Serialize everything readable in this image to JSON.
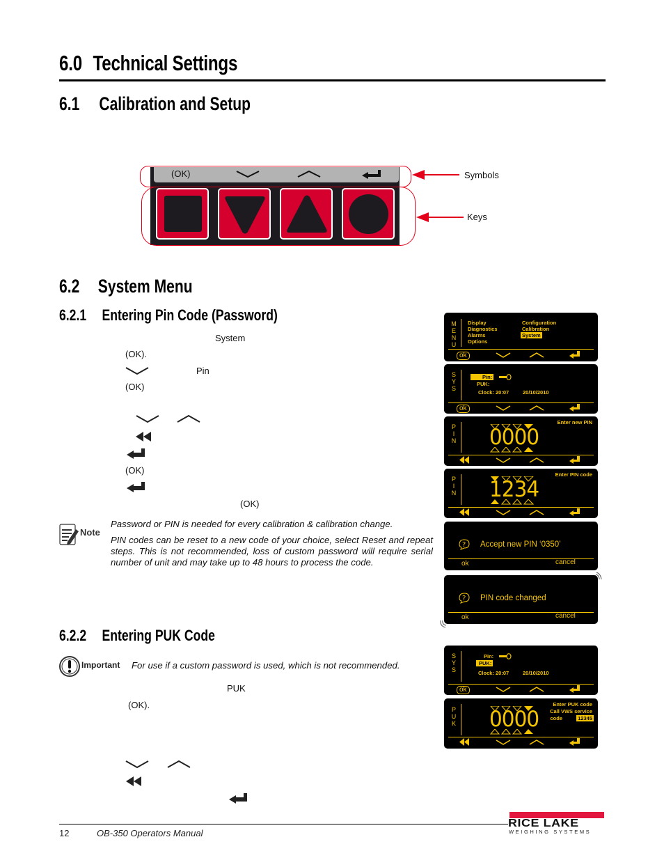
{
  "page": {
    "h1": "6.0  Technical Settings",
    "h1_num": "6.0",
    "h1_title": "Technical Settings",
    "s61_num": "6.1",
    "s61_title": "Calibration and Setup",
    "s62_num": "6.2",
    "s62_title": "System Menu",
    "s621_num": "6.2.1",
    "s621_title": "Entering Pin Code (Password)",
    "s622_num": "6.2.2",
    "s622_title": "Entering PUK Code"
  },
  "keypad": {
    "symbols": [
      "(OK)",
      "chevron-down",
      "chevron-up",
      "enter"
    ],
    "keys": [
      "square",
      "triangle-down",
      "triangle-up",
      "circle"
    ],
    "callout_symbols": "Symbols",
    "callout_keys": "Keys",
    "accent": "#d6002f"
  },
  "pin_steps": {
    "s1_word": "System",
    "s2_ok": "(OK).",
    "s3_word": "Pin",
    "s4_ok": "(OK)",
    "s8_ok": "(OK)",
    "s10_ok": "(OK)"
  },
  "note": {
    "label": "Note",
    "p1": "Password or PIN is needed for every calibration & calibration change.",
    "p2": "PIN codes can be reset to a new code of your choice, select Reset and repeat steps. This is not recommended, loss of custom password will require serial number of unit and may take up to 48 hours to process the code."
  },
  "important": {
    "label": "Important",
    "text": "For use if a custom password is used, which is not recommended."
  },
  "puk_steps": {
    "s1_word": "PUK",
    "s2_ok": "(OK)."
  },
  "displays": {
    "menu": {
      "side": [
        "M",
        "E",
        "N",
        "U"
      ],
      "col1": [
        "Display",
        "Diagnostics",
        "Alarms",
        "Options"
      ],
      "col2": [
        "Configuration",
        "Calibration",
        "System"
      ],
      "selected": "System",
      "ok": "ok"
    },
    "sys1": {
      "side": [
        "S",
        "Y",
        "S"
      ],
      "pin": "Pin:",
      "puk": "PUK:",
      "clock": "Clock: 20:07",
      "date": "20/10/2010",
      "ok": "ok"
    },
    "pin_new": {
      "side": [
        "P",
        "I",
        "N"
      ],
      "title": "Enter new PIN",
      "digits": "0000"
    },
    "pin_enter": {
      "side": [
        "P",
        "I",
        "N"
      ],
      "title": "Enter PIN code",
      "digits": "1234"
    },
    "confirm": {
      "message": "Accept new PIN ‘0350’",
      "ok": "ok",
      "cancel": "cancel"
    },
    "changed": {
      "message": "PIN code changed",
      "ok": "ok",
      "cancel": "cancel"
    },
    "sys2": {
      "side": [
        "S",
        "Y",
        "S"
      ],
      "pin": "Pin:",
      "puk": "PUK:",
      "clock": "Clock: 20:07",
      "date": "20/10/2010",
      "ok": "ok"
    },
    "puk": {
      "side": [
        "P",
        "U",
        "K"
      ],
      "line1": "Enter PUK code",
      "line2": "Call VWS service",
      "line3": "code",
      "service_code": "12345",
      "digits": "0000"
    },
    "lcd_color": "#f5c400"
  },
  "footer": {
    "page_number": "12",
    "manual_title": "OB-350 Operators Manual",
    "brand_top": "RICE LAKE",
    "brand_bottom": "WEIGHING SYSTEMS",
    "brand_color": "#e3173e"
  }
}
